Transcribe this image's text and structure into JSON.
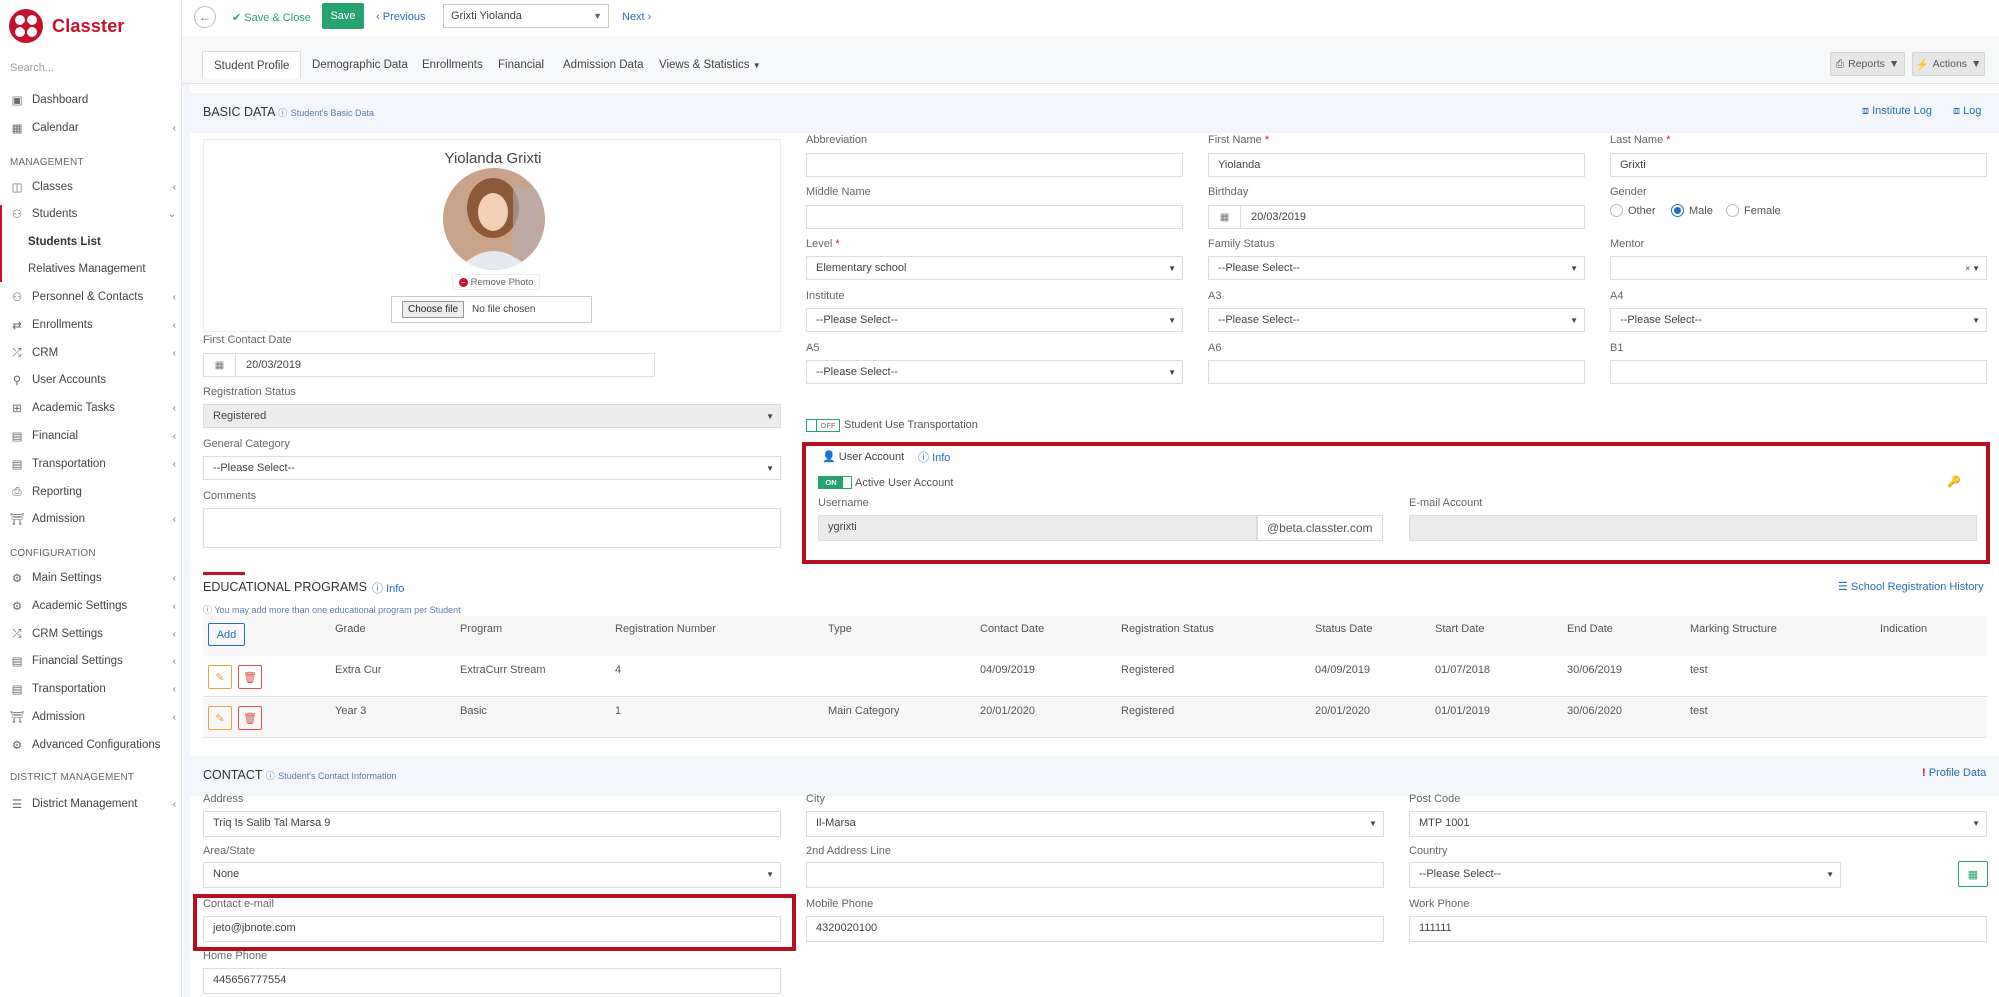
{
  "brand": "Classter",
  "sidebar": {
    "search_placeholder": "Search...",
    "items": [
      {
        "label": "Dashboard",
        "icon": "laptop-icon",
        "chev": false
      },
      {
        "label": "Calendar",
        "icon": "calendar-icon",
        "chev": true
      },
      {
        "label": "Classes",
        "icon": "classes-icon",
        "chev": true
      },
      {
        "label": "Students",
        "icon": "users-icon",
        "chev": true
      },
      {
        "label": "Students List",
        "icon": "",
        "chev": false
      },
      {
        "label": "Relatives Management",
        "icon": "",
        "chev": false
      },
      {
        "label": "Personnel & Contacts",
        "icon": "people-icon",
        "chev": true
      },
      {
        "label": "Enrollments",
        "icon": "arrows-icon",
        "chev": true
      },
      {
        "label": "CRM",
        "icon": "shuffle-icon",
        "chev": true
      },
      {
        "label": "User Accounts",
        "icon": "key-icon",
        "chev": false
      },
      {
        "label": "Academic Tasks",
        "icon": "grid-icon",
        "chev": true
      },
      {
        "label": "Financial",
        "icon": "wallet-icon",
        "chev": true
      },
      {
        "label": "Transportation",
        "icon": "bus-icon",
        "chev": true
      },
      {
        "label": "Reporting",
        "icon": "printer-icon",
        "chev": false
      },
      {
        "label": "Admission",
        "icon": "bank-icon",
        "chev": true
      },
      {
        "label": "Main Settings",
        "icon": "gears-icon",
        "chev": true
      },
      {
        "label": "Academic Settings",
        "icon": "gears-icon",
        "chev": true
      },
      {
        "label": "CRM Settings",
        "icon": "shuffle-icon",
        "chev": true
      },
      {
        "label": "Financial Settings",
        "icon": "wallet-icon",
        "chev": true
      },
      {
        "label": "Transportation",
        "icon": "bus-icon",
        "chev": true
      },
      {
        "label": "Admission",
        "icon": "bank-icon",
        "chev": true
      },
      {
        "label": "Advanced Configurations",
        "icon": "gears-icon",
        "chev": false
      },
      {
        "label": "District Management",
        "icon": "list-icon",
        "chev": true
      }
    ],
    "headers": [
      "MANAGEMENT",
      "CONFIGURATION",
      "DISTRICT MANAGEMENT"
    ]
  },
  "toolbar": {
    "save_close": "Save & Close",
    "save": "Save",
    "previous": "Previous",
    "student_select": "Grixti Yiolanda",
    "next": "Next"
  },
  "tabs": [
    "Student Profile",
    "Demographic Data",
    "Enrollments",
    "Financial",
    "Admission Data",
    "Views & Statistics"
  ],
  "actions": {
    "reports": "Reports",
    "actions": "Actions"
  },
  "basic": {
    "title": "BASIC DATA",
    "subtitle": "Student's Basic Data",
    "institute_log": "Institute Log",
    "log": "Log",
    "photo_name": "Yiolanda Grixti",
    "remove_photo": "Remove Photo",
    "choose_file": "Choose file",
    "no_file": "No file chosen",
    "first_contact_label": "First Contact Date",
    "first_contact": "20/03/2019",
    "reg_status_label": "Registration Status",
    "reg_status": "Registered",
    "gen_cat_label": "General Category",
    "gen_cat": "--Please Select--",
    "comments_label": "Comments",
    "abbreviation_label": "Abbreviation",
    "abbreviation": "",
    "first_name_label": "First Name",
    "first_name": "Yiolanda",
    "last_name_label": "Last Name",
    "last_name": "Grixti",
    "middle_name_label": "Middle Name",
    "middle_name": "",
    "birthday_label": "Birthday",
    "birthday": "20/03/2019",
    "gender_label": "Gender",
    "gender_options": [
      "Other",
      "Male",
      "Female"
    ],
    "gender": "Male",
    "level_label": "Level",
    "level": "Elementary school",
    "family_label": "Family Status",
    "family": "--Please Select--",
    "mentor_label": "Mentor",
    "mentor": "",
    "institute_label": "Institute",
    "institute": "--Please Select--",
    "a3_label": "A3",
    "a3": "--Please Select--",
    "a4_label": "A4",
    "a4": "--Please Select--",
    "a5_label": "A5",
    "a5": "--Please Select--",
    "a6_label": "A6",
    "a6": "",
    "b1_label": "B1",
    "b1": "",
    "transport_toggle": "OFF",
    "transport_label": "Student Use Transportation"
  },
  "account": {
    "title": "User Account",
    "info": "Info",
    "toggle": "ON",
    "active_label": "Active User Account",
    "username_label": "Username",
    "username": "ygrixti",
    "domain": "@beta.classter.com",
    "email_label": "E-mail Account",
    "email": ""
  },
  "programs": {
    "title": "EDUCATIONAL PROGRAMS",
    "info": "Info",
    "note": "You may add more than one educational program per Student",
    "history": "School Registration History",
    "add": "Add",
    "columns": [
      "Grade",
      "Program",
      "Registration Number",
      "Type",
      "Contact Date",
      "Registration Status",
      "Status Date",
      "Start Date",
      "End Date",
      "Marking Structure",
      "Indication"
    ],
    "rows": [
      [
        "Extra Cur",
        "ExtraCurr Stream",
        "4",
        "",
        "04/09/2019",
        "Registered",
        "04/09/2019",
        "01/07/2018",
        "30/06/2019",
        "test",
        ""
      ],
      [
        "Year 3",
        "Basic",
        "1",
        "Main Category",
        "20/01/2020",
        "Registered",
        "20/01/2020",
        "01/01/2019",
        "30/06/2020",
        "test",
        ""
      ]
    ]
  },
  "contact": {
    "title": "CONTACT",
    "subtitle": "Student's Contact Information",
    "profile_data": "Profile Data",
    "address_label": "Address",
    "address": "Triq Is Salib Tal Marsa 9",
    "city_label": "City",
    "city": "Il-Marsa",
    "postcode_label": "Post Code",
    "postcode": "MTP 1001",
    "area_label": "Area/State",
    "area": "None",
    "addr2_label": "2nd Address Line",
    "addr2": "",
    "country_label": "Country",
    "country": "--Please Select--",
    "email_label": "Contact e-mail",
    "email": "jeto@jbnote.com",
    "mobile_label": "Mobile Phone",
    "mobile": "4320020100",
    "work_label": "Work Phone",
    "work": "111111",
    "home_label": "Home Phone",
    "home": "445656777554"
  }
}
